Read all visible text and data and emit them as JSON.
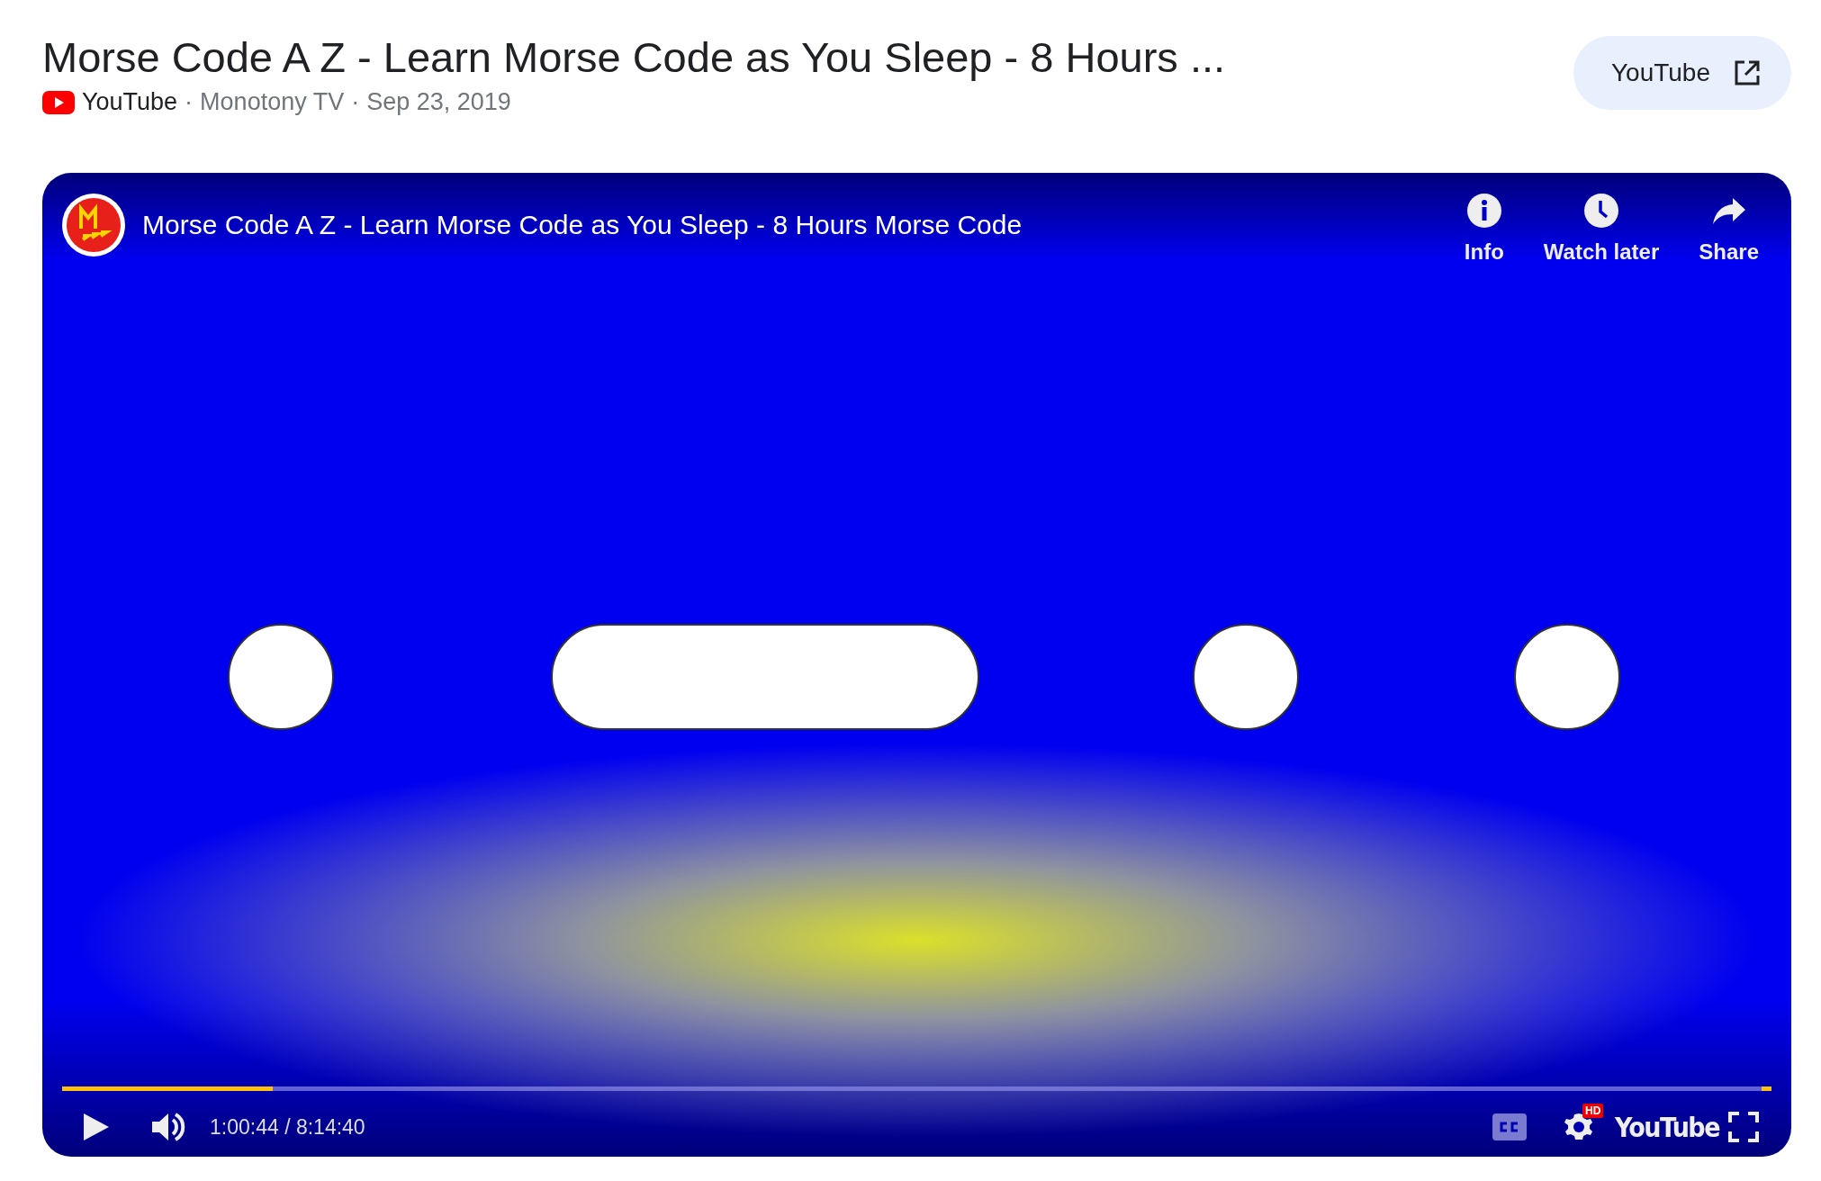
{
  "header": {
    "title": "Morse Code A Z - Learn Morse Code as You Sleep - 8 Hours ...",
    "source": "YouTube",
    "separator_1": "·",
    "channel": "Monotony TV",
    "separator_2": "·",
    "date": "Sep 23, 2019"
  },
  "open_button": {
    "label": "YouTube"
  },
  "player": {
    "title": "Morse Code A Z - Learn Morse Code as You Sleep - 8 Hours Morse Code",
    "actions": [
      {
        "label": "Info",
        "kind": "info"
      },
      {
        "label": "Watch later",
        "kind": "clock"
      },
      {
        "label": "Share",
        "kind": "share"
      }
    ],
    "progress": {
      "level": 0.123
    },
    "time": "1:00:44 / 8:14:40",
    "hd_badge": "HD",
    "logo": "YouTube"
  }
}
